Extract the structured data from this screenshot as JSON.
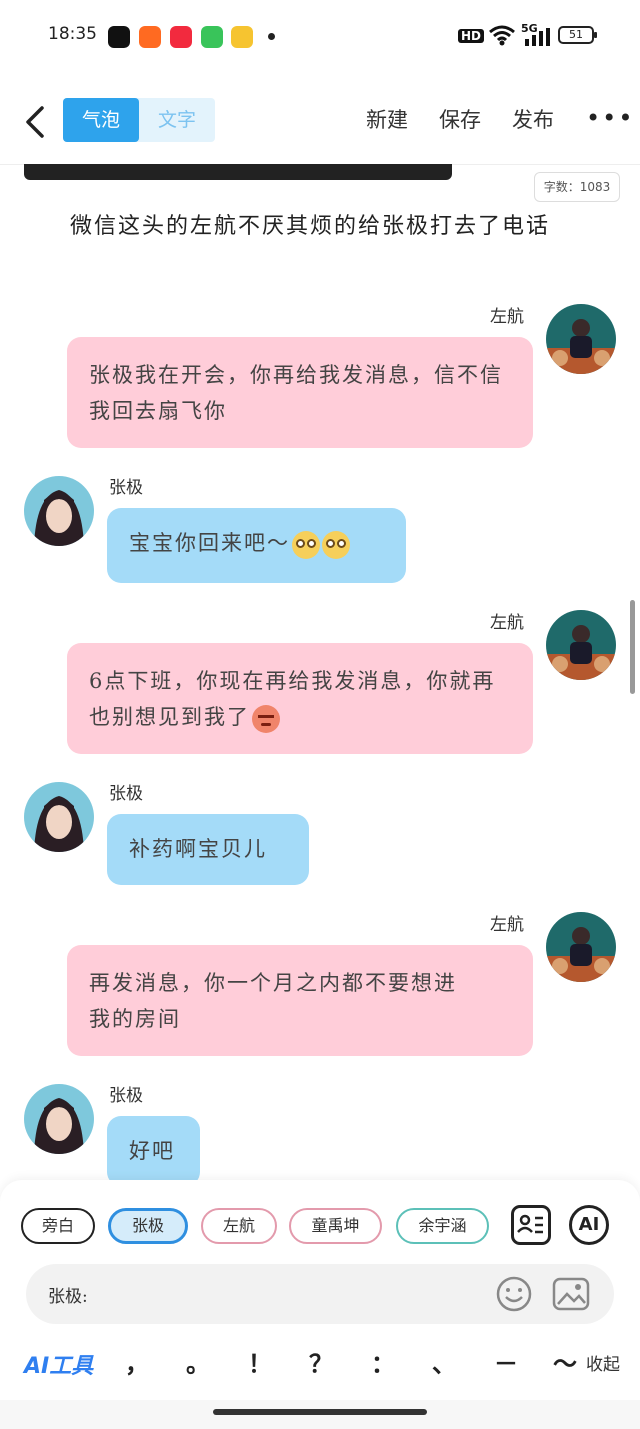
{
  "status_bar": {
    "time": "18:35",
    "hd": "HD",
    "network": "5G",
    "battery": "51"
  },
  "nav": {
    "tab_bubble": "气泡",
    "tab_text": "文字",
    "new": "新建",
    "save": "保存",
    "publish": "发布",
    "more": "•••"
  },
  "word_count": "字数：1083",
  "narration": "微信这头的左航不厌其烦的给张极打去了电话",
  "messages": [
    {
      "sender": "左航",
      "side": "right",
      "text": "张极我在开会，你再给我发消息，信不信我回去扇飞你"
    },
    {
      "sender": "张极",
      "side": "left",
      "text": "宝宝你回来吧～"
    },
    {
      "sender": "左航",
      "side": "right",
      "text": "6点下班，你现在再给我发消息，你就再也别想见到我了"
    },
    {
      "sender": "张极",
      "side": "left",
      "text": "补药啊宝贝儿"
    },
    {
      "sender": "左航",
      "side": "right",
      "text": "再发消息，你一个月之内都不要想进我的房间"
    },
    {
      "sender": "张极",
      "side": "left",
      "text": "好吧"
    }
  ],
  "roles": [
    "旁白",
    "张极",
    "左航",
    "童禹坤",
    "余宇涵"
  ],
  "ai_label": "AI",
  "input": {
    "prefix": "张极:"
  },
  "toolbar": {
    "ai_tool": "AI工具",
    "punctuation": [
      "，",
      "。",
      "！",
      "？",
      "：",
      "、",
      "－",
      "～"
    ],
    "collapse": "收起"
  },
  "colors": {
    "accent": "#2ea3ec",
    "right_bubble": "#ffcdd9",
    "left_bubble": "#a4dbf8",
    "narration_chip": "#222222",
    "selected_chip": "#2f8fe0",
    "pink_chip": "#e39aac",
    "teal_chip": "#5cc0b8"
  }
}
